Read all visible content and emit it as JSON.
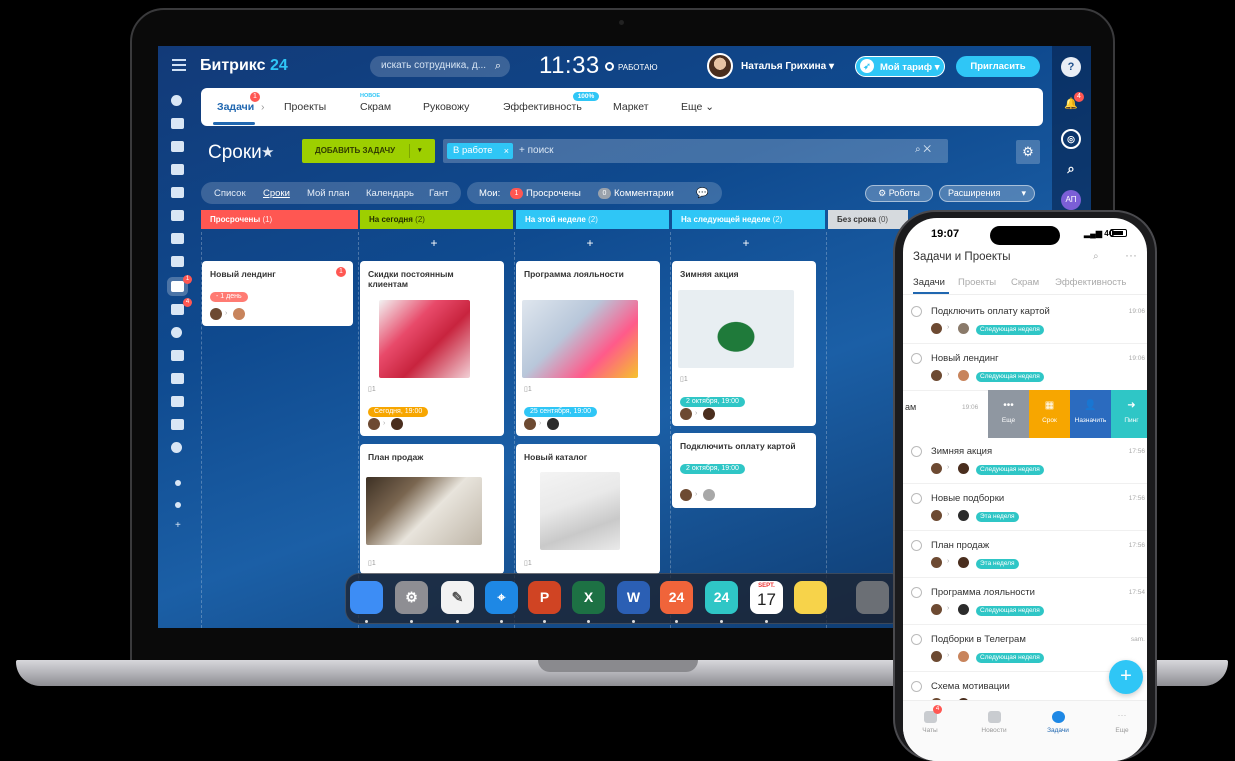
{
  "laptop": {
    "logo": {
      "name": "Битрикс",
      "num": "24"
    },
    "search_placeholder": "искать сотрудника, д...",
    "clock": "11:33",
    "work_status": "РАБОТАЮ",
    "user_name": "Наталья Грихина",
    "tariff_label": "Мой тариф",
    "invite_label": "Пригласить",
    "right_rail": {
      "help": "?",
      "notifications_badge": "4",
      "avatar_initials": "АП"
    },
    "left_rail": {
      "tasks_badge": "1",
      "filter_badge": "4"
    },
    "tabs": [
      {
        "label": "Задачи",
        "badge": "1"
      },
      {
        "label": "Проекты"
      },
      {
        "label": "Скрам",
        "tag": "НОВОЕ"
      },
      {
        "label": "Руковожу"
      },
      {
        "label": "Эффективность",
        "tag": "100%"
      },
      {
        "label": "Маркет"
      },
      {
        "label": "Еще"
      }
    ],
    "page_title": "Сроки",
    "add_task": "ДОБАВИТЬ ЗАДАЧУ",
    "filter": {
      "chip": "В работе",
      "placeholder": "+ поиск"
    },
    "views": [
      "Список",
      "Сроки",
      "Мой план",
      "Календарь",
      "Гант"
    ],
    "mine": {
      "label": "Мои:",
      "overdue_count": "1",
      "overdue": "Просрочены",
      "comments_count": "0",
      "comments": "Комментарии"
    },
    "robots": "Роботы",
    "extensions": "Расширения",
    "columns": [
      {
        "title": "Просрочены",
        "count": "(1)",
        "color": "#ff5752"
      },
      {
        "title": "На сегодня",
        "count": "(2)",
        "color": "#9dcf00"
      },
      {
        "title": "На этой неделе",
        "count": "(2)",
        "color": "#2fc6f6"
      },
      {
        "title": "На следующей неделе",
        "count": "(2)",
        "color": "#2fc6f6"
      },
      {
        "title": "Без срока",
        "count": "(0)",
        "color": "#a8adb4"
      }
    ],
    "cards": {
      "c1": {
        "title": "Новый лендинг",
        "badge": "1",
        "deadline": "- 1 день"
      },
      "c2": {
        "title": "Скидки постоянным клиентам",
        "files": "1",
        "deadline": "Сегодня, 19:00"
      },
      "c3": {
        "title": "План продаж",
        "files": "1"
      },
      "c4": {
        "title": "Программа лояльности",
        "files": "1",
        "deadline": "25 сентября, 19:00"
      },
      "c5": {
        "title": "Новый каталог",
        "files": "1"
      },
      "c6": {
        "title": "Зимняя акция",
        "files": "1",
        "deadline": "2 октября, 19:00"
      },
      "c7": {
        "title": "Подключить оплату картой",
        "deadline": "2 октября, 19:00"
      }
    },
    "dock": [
      {
        "name": "finder-app",
        "glyph": "",
        "bg": "#3d8df5"
      },
      {
        "name": "settings-app",
        "glyph": "⚙",
        "bg": "#8e8e93"
      },
      {
        "name": "notes-app",
        "glyph": "✎",
        "bg": "#f2f2f2"
      },
      {
        "name": "safari-app",
        "glyph": "⌖",
        "bg": "#1e88e5"
      },
      {
        "name": "powerpoint-app",
        "glyph": "P",
        "bg": "#d04423"
      },
      {
        "name": "excel-app",
        "glyph": "X",
        "bg": "#1d7144"
      },
      {
        "name": "word-app",
        "glyph": "W",
        "bg": "#2b5fb4"
      },
      {
        "name": "bitrix-chat-app",
        "glyph": "24",
        "bg": "#f0643a"
      },
      {
        "name": "bitrix-app",
        "glyph": "24",
        "bg": "#2fc6c6"
      },
      {
        "name": "calendar-app",
        "glyph": "17",
        "bg": "#ffffff"
      },
      {
        "name": "stickies-app",
        "glyph": "",
        "bg": "#f7d34a"
      },
      {
        "name": "trash-app",
        "glyph": "",
        "bg": "#6b6f75"
      }
    ],
    "calendar_month": "SEPT."
  },
  "phone": {
    "time": "19:07",
    "network": "4G",
    "title": "Задачи и Проекты",
    "tabs": [
      "Задачи",
      "Проекты",
      "Скрам",
      "Эффективность"
    ],
    "tasks": [
      {
        "name": "Подключить оплату картой",
        "time": "19:06",
        "tag": "Следующая неделя"
      },
      {
        "name": "Новый лендинг",
        "time": "19:06",
        "tag": "Следующая неделя"
      },
      {
        "name": "Зимняя акция",
        "time": "17:56",
        "tag": "Следующая неделя"
      },
      {
        "name": "Новые подборки",
        "time": "17:56",
        "tag": "Эта неделя"
      },
      {
        "name": "План продаж",
        "time": "17:56",
        "tag": "Эта неделя"
      },
      {
        "name": "Программа лояльности",
        "time": "17:54",
        "tag": "Следующая неделя"
      },
      {
        "name": "Подборки в Телеграм",
        "time": "sam.",
        "tag": "Следующая неделя"
      },
      {
        "name": "Схема мотивации",
        "time": "",
        "tag": ""
      }
    ],
    "swipe": {
      "text": "ам",
      "time": "19:06",
      "actions": [
        {
          "label": "Еще",
          "icon": "•••",
          "color": "#8f97a1"
        },
        {
          "label": "Срок",
          "icon": "▦",
          "color": "#f7a600"
        },
        {
          "label": "Назначить",
          "icon": "👤",
          "color": "#2b6bbf"
        },
        {
          "label": "Пинг",
          "icon": "➜",
          "color": "#2fc6c6"
        }
      ]
    },
    "fab": "+",
    "nav": [
      {
        "label": "Чаты",
        "badge": "4"
      },
      {
        "label": "Новости"
      },
      {
        "label": "Задачи"
      },
      {
        "label": "Еще"
      }
    ]
  }
}
